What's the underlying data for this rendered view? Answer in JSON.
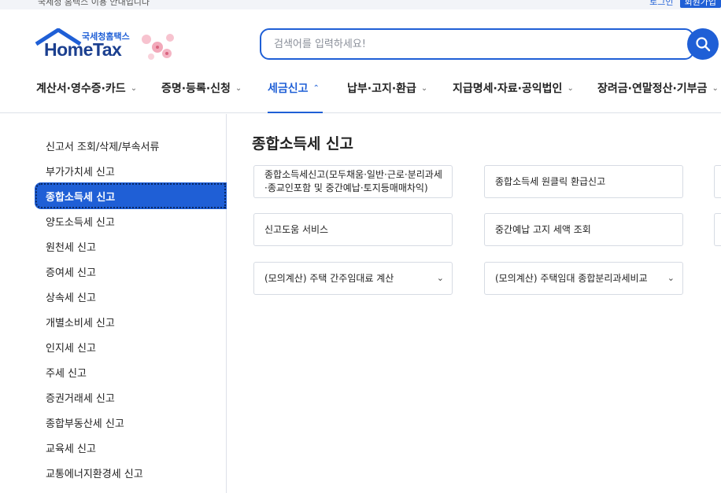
{
  "topbar": {
    "notice": "국세청 홈택스 이용 안내입니다",
    "login": "로그인",
    "signup": "회원가입"
  },
  "logo": {
    "sub": "국세청홈택스",
    "main": "HomeTax"
  },
  "search": {
    "placeholder": "검색어를 입력하세요!"
  },
  "gnb": [
    {
      "label": "계산서·영수증·카드",
      "chevron": "⌄"
    },
    {
      "label": "증명·등록·신청",
      "chevron": "⌄"
    },
    {
      "label": "세금신고",
      "chevron": "⌃",
      "active": true
    },
    {
      "label": "납부·고지·환급",
      "chevron": "⌄"
    },
    {
      "label": "지급명세·자료·공익법인",
      "chevron": "⌄"
    },
    {
      "label": "장려금·연말정산·기부금",
      "chevron": "⌄"
    }
  ],
  "sidebar": {
    "items": [
      {
        "label": "신고서 조회/삭제/부속서류"
      },
      {
        "label": "부가가치세 신고"
      },
      {
        "label": "종합소득세 신고",
        "active": true
      },
      {
        "label": "양도소득세 신고"
      },
      {
        "label": "원천세 신고"
      },
      {
        "label": "증여세 신고"
      },
      {
        "label": "상속세 신고"
      },
      {
        "label": "개별소비세 신고"
      },
      {
        "label": "인지세 신고"
      },
      {
        "label": "주세 신고"
      },
      {
        "label": "증권거래세 신고"
      },
      {
        "label": "종합부동산세 신고"
      },
      {
        "label": "교육세 신고"
      },
      {
        "label": "교통에너지환경세 신고"
      }
    ]
  },
  "content": {
    "title": "종합소득세 신고",
    "cards": [
      {
        "label": "종합소득세신고(모두채움·일반·근로·분리과세·종교인포함 및 중간예납·토지등매매차익)"
      },
      {
        "label": "종합소득세 원클릭 환급신고"
      },
      {
        "label": "신고도움 서비스"
      },
      {
        "label": "중간예납 고지 세액 조회"
      },
      {
        "label": "(모의계산) 주택 간주임대료 계산",
        "chevron": "⌄"
      },
      {
        "label": "(모의계산) 주택임대 종합분리과세비교",
        "chevron": "⌄"
      }
    ]
  },
  "colors": {
    "accent": "#1f5fd6",
    "logo": "#1b3f8f",
    "border": "#d6dbe3"
  }
}
